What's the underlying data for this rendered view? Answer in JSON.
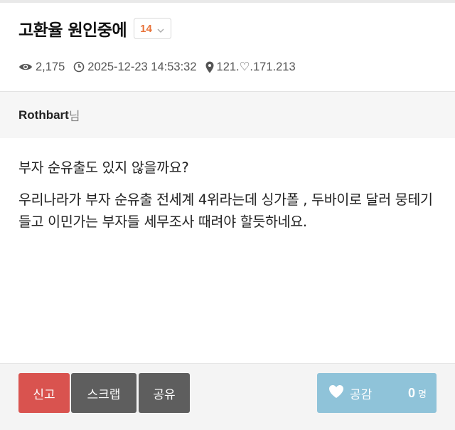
{
  "post": {
    "title": "고환율 원인중에",
    "comment_count": "14",
    "views": "2,175",
    "datetime": "2025-12-23 14:53:32",
    "ip": "121.♡.171.213"
  },
  "author": {
    "name": "Rothbart",
    "suffix": "님"
  },
  "content": {
    "paragraphs": [
      "부자 순유출도 있지 않을까요?",
      "우리나라가 부자 순유출 전세계 4위라는데 싱가폴 , 두바이로 달러 뭉테기들고 이민가는 부자들 세무조사 때려야 할듯하네요."
    ]
  },
  "actions": {
    "report_label": "신고",
    "scrap_label": "스크랩",
    "share_label": "공유",
    "like_label": "공감",
    "like_count": "0",
    "like_unit": "명"
  },
  "icons": {
    "views": "eye-icon",
    "datetime": "clock-icon",
    "ip": "map-marker-icon",
    "like": "heart-icon",
    "dropdown": "chevron-down-icon"
  },
  "colors": {
    "comment_count": "#e8733a",
    "report_button": "#d9534f",
    "scrap_button": "#5e5e5e",
    "share_button": "#5e5e5e",
    "like_button": "#8fc3d9"
  }
}
